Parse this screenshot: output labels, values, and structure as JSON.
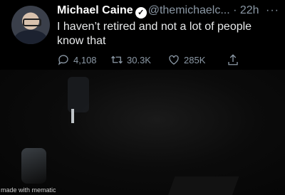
{
  "tweet": {
    "name": "Michael Caine",
    "handle": "@themichaelc...",
    "time": "· 22h",
    "more": "···",
    "text": "I haven’t retired and not a lot of people know that",
    "replies": "4,108",
    "retweets": "30.3K",
    "likes": "285K"
  },
  "icons": {
    "verified": "verified-badge-icon",
    "reply": "reply-icon",
    "retweet": "retweet-icon",
    "like": "heart-icon",
    "share": "share-icon"
  },
  "video": {
    "watermark": "made with mematic"
  }
}
